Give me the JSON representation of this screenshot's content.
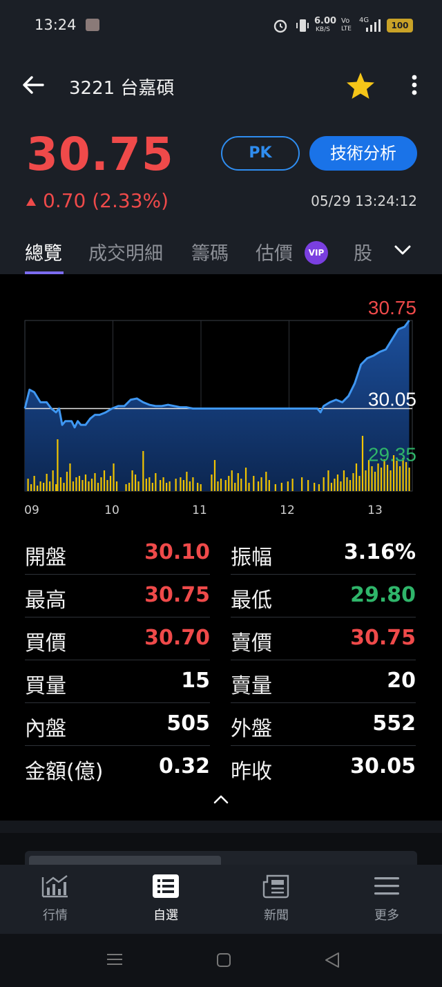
{
  "status_bar": {
    "time": "13:24",
    "net_speed": "6.00",
    "net_unit": "KB/S",
    "volte": "Vo",
    "lte": "LTE",
    "signal": "4G",
    "battery": "100"
  },
  "header": {
    "stock_title": "3221 台嘉碩"
  },
  "quote": {
    "price": "30.75",
    "change": "0.70 (2.33%)",
    "pk_label": "PK",
    "tech_analysis_label": "技術分析",
    "timestamp": "05/29 13:24:12",
    "up_color": "#ef4a4a",
    "down_color": "#2fb56a",
    "accent": "#1a73e8"
  },
  "tabs": [
    {
      "label": "總覽",
      "active": true
    },
    {
      "label": "成交明細"
    },
    {
      "label": "籌碼"
    },
    {
      "label": "估價",
      "badge": "VIP"
    },
    {
      "label": "股"
    }
  ],
  "chart_data": {
    "type": "area",
    "x_ticks": [
      "09",
      "10",
      "11",
      "12",
      "13"
    ],
    "price_labels": {
      "high": "30.75",
      "ref": "30.05",
      "low": "29.35"
    },
    "ylim": [
      29.35,
      30.75
    ],
    "reference": 30.05,
    "price_series": [
      [
        0.0,
        30.05
      ],
      [
        0.15,
        30.2
      ],
      [
        0.3,
        30.18
      ],
      [
        0.5,
        30.1
      ],
      [
        0.7,
        30.1
      ],
      [
        0.85,
        30.05
      ],
      [
        1.0,
        30.02
      ],
      [
        1.1,
        30.05
      ],
      [
        1.2,
        29.92
      ],
      [
        1.3,
        29.95
      ],
      [
        1.5,
        29.95
      ],
      [
        1.6,
        29.9
      ],
      [
        1.7,
        29.95
      ],
      [
        1.8,
        29.92
      ],
      [
        1.95,
        29.92
      ],
      [
        2.1,
        29.97
      ],
      [
        2.25,
        30.0
      ],
      [
        2.4,
        30.0
      ],
      [
        2.6,
        30.02
      ],
      [
        2.8,
        30.05
      ],
      [
        3.0,
        30.07
      ],
      [
        3.2,
        30.07
      ],
      [
        3.4,
        30.12
      ],
      [
        3.6,
        30.13
      ],
      [
        3.8,
        30.1
      ],
      [
        4.0,
        30.08
      ],
      [
        4.2,
        30.07
      ],
      [
        4.4,
        30.07
      ],
      [
        4.6,
        30.08
      ],
      [
        4.8,
        30.07
      ],
      [
        5.0,
        30.06
      ],
      [
        5.2,
        30.06
      ],
      [
        5.4,
        30.05
      ],
      [
        5.6,
        30.05
      ],
      [
        5.8,
        30.05
      ],
      [
        6.0,
        30.05
      ],
      [
        6.5,
        30.05
      ],
      [
        7.0,
        30.05
      ],
      [
        7.5,
        30.05
      ],
      [
        8.0,
        30.05
      ],
      [
        8.5,
        30.05
      ],
      [
        9.0,
        30.05
      ],
      [
        9.4,
        30.05
      ],
      [
        9.5,
        30.02
      ],
      [
        9.6,
        30.07
      ],
      [
        9.8,
        30.1
      ],
      [
        10.0,
        30.12
      ],
      [
        10.2,
        30.1
      ],
      [
        10.4,
        30.15
      ],
      [
        10.6,
        30.25
      ],
      [
        10.8,
        30.4
      ],
      [
        11.0,
        30.45
      ],
      [
        11.2,
        30.47
      ],
      [
        11.4,
        30.5
      ],
      [
        11.6,
        30.52
      ],
      [
        11.8,
        30.6
      ],
      [
        12.0,
        30.68
      ],
      [
        12.2,
        30.7
      ],
      [
        12.35,
        30.75
      ]
    ],
    "volume_series": [
      [
        0.1,
        18
      ],
      [
        0.2,
        10
      ],
      [
        0.3,
        22
      ],
      [
        0.4,
        8
      ],
      [
        0.5,
        14
      ],
      [
        0.6,
        12
      ],
      [
        0.7,
        25
      ],
      [
        0.8,
        14
      ],
      [
        0.9,
        30
      ],
      [
        1.0,
        10
      ],
      [
        1.05,
        75
      ],
      [
        1.15,
        20
      ],
      [
        1.25,
        12
      ],
      [
        1.35,
        28
      ],
      [
        1.45,
        40
      ],
      [
        1.55,
        14
      ],
      [
        1.65,
        20
      ],
      [
        1.75,
        22
      ],
      [
        1.85,
        16
      ],
      [
        1.95,
        24
      ],
      [
        2.05,
        14
      ],
      [
        2.15,
        18
      ],
      [
        2.25,
        26
      ],
      [
        2.35,
        12
      ],
      [
        2.45,
        20
      ],
      [
        2.55,
        30
      ],
      [
        2.65,
        16
      ],
      [
        2.75,
        22
      ],
      [
        2.85,
        40
      ],
      [
        2.95,
        14
      ],
      [
        3.25,
        10
      ],
      [
        3.35,
        12
      ],
      [
        3.45,
        30
      ],
      [
        3.55,
        24
      ],
      [
        3.65,
        14
      ],
      [
        3.8,
        58
      ],
      [
        3.9,
        18
      ],
      [
        4.0,
        20
      ],
      [
        4.1,
        12
      ],
      [
        4.2,
        26
      ],
      [
        4.35,
        16
      ],
      [
        4.45,
        20
      ],
      [
        4.55,
        12
      ],
      [
        4.65,
        14
      ],
      [
        4.85,
        18
      ],
      [
        5.0,
        20
      ],
      [
        5.1,
        16
      ],
      [
        5.2,
        28
      ],
      [
        5.3,
        14
      ],
      [
        5.4,
        20
      ],
      [
        5.55,
        12
      ],
      [
        5.65,
        10
      ],
      [
        6.0,
        24
      ],
      [
        6.1,
        45
      ],
      [
        6.2,
        14
      ],
      [
        6.3,
        18
      ],
      [
        6.45,
        16
      ],
      [
        6.55,
        22
      ],
      [
        6.65,
        30
      ],
      [
        6.75,
        12
      ],
      [
        6.85,
        26
      ],
      [
        6.95,
        18
      ],
      [
        7.1,
        34
      ],
      [
        7.2,
        12
      ],
      [
        7.35,
        22
      ],
      [
        7.5,
        14
      ],
      [
        7.6,
        20
      ],
      [
        7.75,
        28
      ],
      [
        7.85,
        16
      ],
      [
        8.05,
        10
      ],
      [
        8.25,
        12
      ],
      [
        8.45,
        14
      ],
      [
        8.6,
        18
      ],
      [
        8.9,
        20
      ],
      [
        9.1,
        16
      ],
      [
        9.3,
        12
      ],
      [
        9.45,
        10
      ],
      [
        9.6,
        20
      ],
      [
        9.75,
        30
      ],
      [
        9.85,
        12
      ],
      [
        9.95,
        18
      ],
      [
        10.05,
        24
      ],
      [
        10.15,
        14
      ],
      [
        10.25,
        30
      ],
      [
        10.35,
        20
      ],
      [
        10.45,
        16
      ],
      [
        10.55,
        26
      ],
      [
        10.65,
        40
      ],
      [
        10.75,
        22
      ],
      [
        10.85,
        80
      ],
      [
        10.95,
        30
      ],
      [
        11.05,
        45
      ],
      [
        11.15,
        36
      ],
      [
        11.25,
        28
      ],
      [
        11.35,
        40
      ],
      [
        11.45,
        34
      ],
      [
        11.55,
        46
      ],
      [
        11.65,
        38
      ],
      [
        11.75,
        30
      ],
      [
        11.85,
        52
      ],
      [
        11.95,
        44
      ],
      [
        12.05,
        36
      ],
      [
        12.15,
        48
      ],
      [
        12.25,
        42
      ],
      [
        12.35,
        34
      ]
    ]
  },
  "stats_left": [
    {
      "label": "開盤",
      "value": "30.10",
      "tone": "up"
    },
    {
      "label": "最高",
      "value": "30.75",
      "tone": "up"
    },
    {
      "label": "買價",
      "value": "30.70",
      "tone": "up"
    },
    {
      "label": "買量",
      "value": "15",
      "tone": "neutral"
    },
    {
      "label": "內盤",
      "value": "505",
      "tone": "neutral"
    },
    {
      "label": "金額(億)",
      "value": "0.32",
      "tone": "neutral"
    }
  ],
  "stats_right": [
    {
      "label": "振幅",
      "value": "3.16%",
      "tone": "neutral"
    },
    {
      "label": "最低",
      "value": "29.80",
      "tone": "down"
    },
    {
      "label": "賣價",
      "value": "30.75",
      "tone": "up"
    },
    {
      "label": "賣量",
      "value": "20",
      "tone": "neutral"
    },
    {
      "label": "外盤",
      "value": "552",
      "tone": "neutral"
    },
    {
      "label": "昨收",
      "value": "30.05",
      "tone": "neutral"
    }
  ],
  "bottom_nav": [
    {
      "label": "行情",
      "icon": "chart-icon",
      "active": false
    },
    {
      "label": "自選",
      "icon": "list-icon",
      "active": true
    },
    {
      "label": "新聞",
      "icon": "news-icon",
      "active": false
    },
    {
      "label": "更多",
      "icon": "menu-icon",
      "active": false
    }
  ]
}
